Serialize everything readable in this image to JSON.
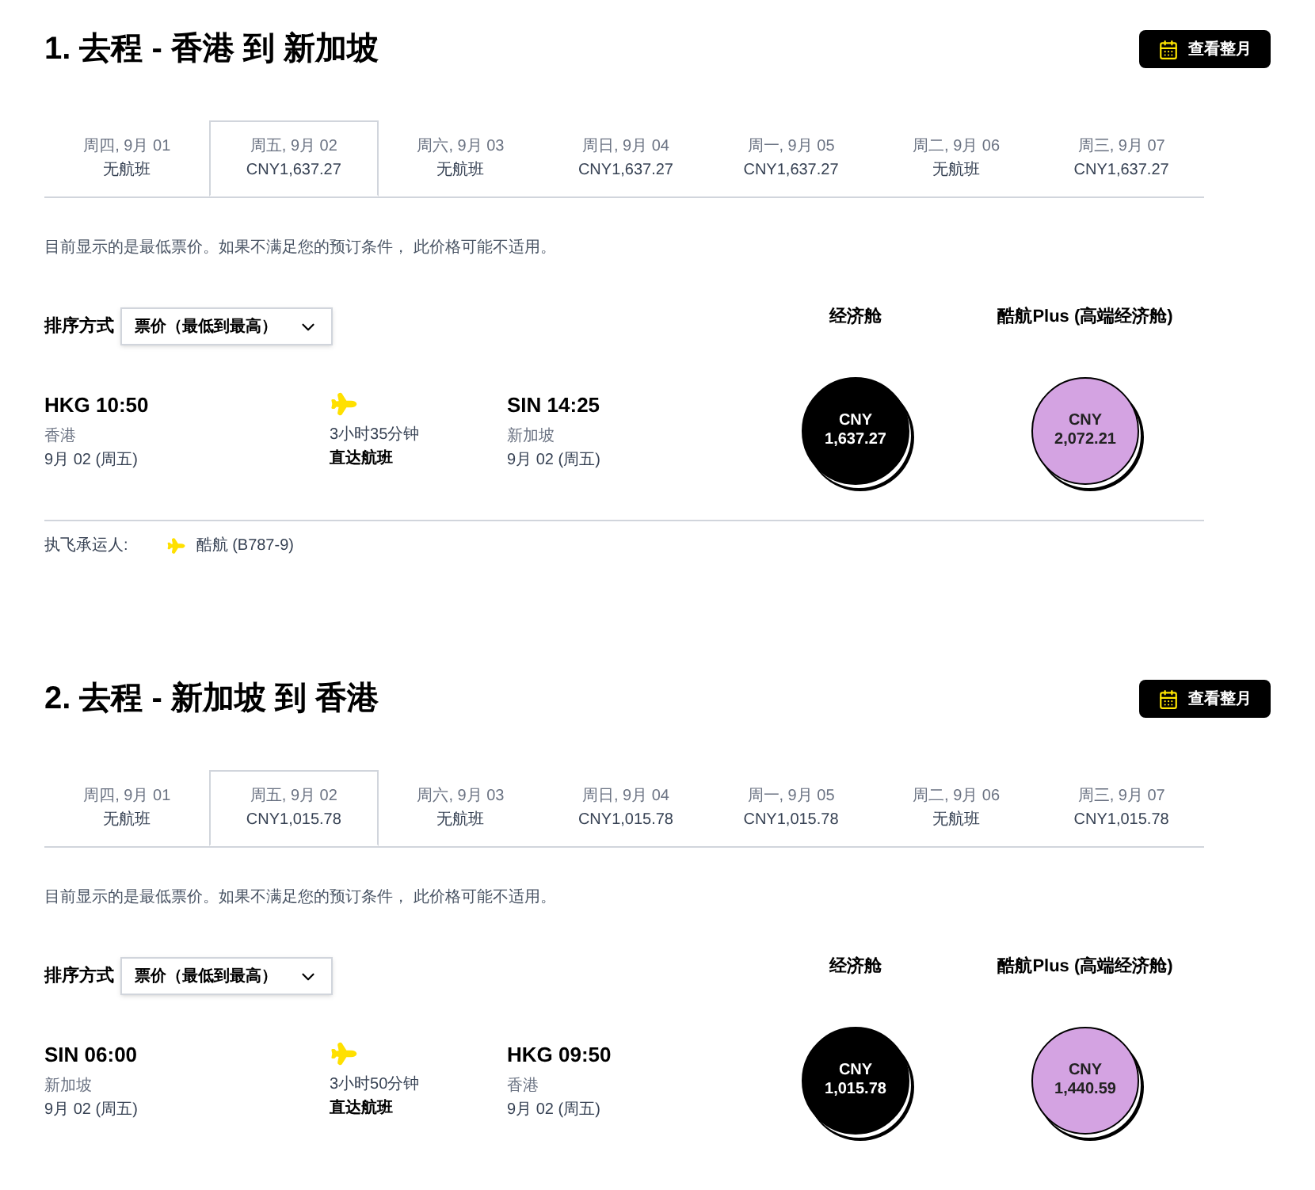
{
  "sections": [
    {
      "title": "1. 去程 - 香港 到 新加坡",
      "calendar_button": "查看整月",
      "dates": [
        {
          "day": "周四, 9月 01",
          "price": "无航班",
          "selected": false
        },
        {
          "day": "周五, 9月 02",
          "price": "CNY1,637.27",
          "selected": true
        },
        {
          "day": "周六, 9月 03",
          "price": "无航班",
          "selected": false
        },
        {
          "day": "周日, 9月 04",
          "price": "CNY1,637.27",
          "selected": false
        },
        {
          "day": "周一, 9月 05",
          "price": "CNY1,637.27",
          "selected": false
        },
        {
          "day": "周二, 9月 06",
          "price": "无航班",
          "selected": false
        },
        {
          "day": "周三, 9月 07",
          "price": "CNY1,637.27",
          "selected": false
        }
      ],
      "note": "目前显示的是最低票价。如果不满足您的预订条件， 此价格可能不适用。",
      "sort": {
        "label": "排序方式",
        "value": "票价（最低到最高）"
      },
      "cabins": [
        "经济舱",
        "酷航Plus (高端经济舱)"
      ],
      "flight": {
        "depart": {
          "time": "HKG 10:50",
          "city": "香港",
          "date": "9月 02 (周五)"
        },
        "duration": "3小时35分钟",
        "stops": "直达航班",
        "arrive": {
          "time": "SIN 14:25",
          "city": "新加坡",
          "date": "9月 02 (周五)"
        },
        "fares": [
          {
            "currency": "CNY",
            "amount": "1,637.27",
            "color": "#000000"
          },
          {
            "currency": "CNY",
            "amount": "2,072.21",
            "color": "#d4a3e2"
          }
        ]
      },
      "carrier": {
        "label": "执飞承运人:",
        "name": "酷航",
        "aircraft": "(B787-9)"
      }
    },
    {
      "title": "2. 去程 - 新加坡 到 香港",
      "calendar_button": "查看整月",
      "dates": [
        {
          "day": "周四, 9月 01",
          "price": "无航班",
          "selected": false
        },
        {
          "day": "周五, 9月 02",
          "price": "CNY1,015.78",
          "selected": true
        },
        {
          "day": "周六, 9月 03",
          "price": "无航班",
          "selected": false
        },
        {
          "day": "周日, 9月 04",
          "price": "CNY1,015.78",
          "selected": false
        },
        {
          "day": "周一, 9月 05",
          "price": "CNY1,015.78",
          "selected": false
        },
        {
          "day": "周二, 9月 06",
          "price": "无航班",
          "selected": false
        },
        {
          "day": "周三, 9月 07",
          "price": "CNY1,015.78",
          "selected": false
        }
      ],
      "note": "目前显示的是最低票价。如果不满足您的预订条件， 此价格可能不适用。",
      "sort": {
        "label": "排序方式",
        "value": "票价（最低到最高）"
      },
      "cabins": [
        "经济舱",
        "酷航Plus (高端经济舱)"
      ],
      "flight": {
        "depart": {
          "time": "SIN 06:00",
          "city": "新加坡",
          "date": "9月 02 (周五)"
        },
        "duration": "3小时50分钟",
        "stops": "直达航班",
        "arrive": {
          "time": "HKG 09:50",
          "city": "香港",
          "date": "9月 02 (周五)"
        },
        "fares": [
          {
            "currency": "CNY",
            "amount": "1,015.78",
            "color": "#000000"
          },
          {
            "currency": "CNY",
            "amount": "1,440.59",
            "color": "#d4a3e2"
          }
        ]
      }
    }
  ]
}
